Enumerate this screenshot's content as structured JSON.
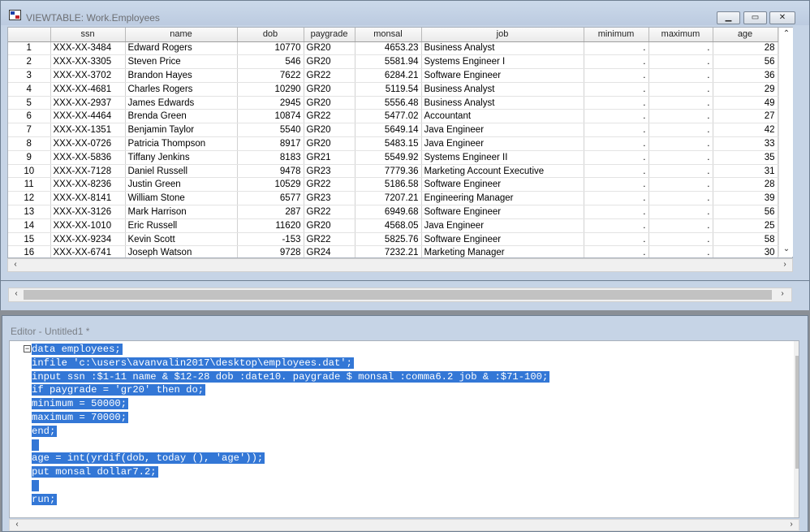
{
  "viewtable": {
    "title": "VIEWTABLE: Work.Employees",
    "columns": [
      "ssn",
      "name",
      "dob",
      "paygrade",
      "monsal",
      "job",
      "minimum",
      "maximum",
      "age"
    ],
    "rows": [
      [
        "1",
        "XXX-XX-3484",
        "Edward Rogers",
        "10770",
        "GR20",
        "4653.23",
        "Business Analyst",
        ".",
        ".",
        "28"
      ],
      [
        "2",
        "XXX-XX-3305",
        "Steven Price",
        "546",
        "GR20",
        "5581.94",
        "Systems Engineer I",
        ".",
        ".",
        "56"
      ],
      [
        "3",
        "XXX-XX-3702",
        "Brandon Hayes",
        "7622",
        "GR22",
        "6284.21",
        "Software Engineer",
        ".",
        ".",
        "36"
      ],
      [
        "4",
        "XXX-XX-4681",
        "Charles Rogers",
        "10290",
        "GR20",
        "5119.54",
        "Business Analyst",
        ".",
        ".",
        "29"
      ],
      [
        "5",
        "XXX-XX-2937",
        "James Edwards",
        "2945",
        "GR20",
        "5556.48",
        "Business Analyst",
        ".",
        ".",
        "49"
      ],
      [
        "6",
        "XXX-XX-4464",
        "Brenda Green",
        "10874",
        "GR22",
        "5477.02",
        "Accountant",
        ".",
        ".",
        "27"
      ],
      [
        "7",
        "XXX-XX-1351",
        "Benjamin Taylor",
        "5540",
        "GR20",
        "5649.14",
        "Java Engineer",
        ".",
        ".",
        "42"
      ],
      [
        "8",
        "XXX-XX-0726",
        "Patricia Thompson",
        "8917",
        "GR20",
        "5483.15",
        "Java Engineer",
        ".",
        ".",
        "33"
      ],
      [
        "9",
        "XXX-XX-5836",
        "Tiffany Jenkins",
        "8183",
        "GR21",
        "5549.92",
        "Systems Engineer II",
        ".",
        ".",
        "35"
      ],
      [
        "10",
        "XXX-XX-7128",
        "Daniel Russell",
        "9478",
        "GR23",
        "7779.36",
        "Marketing Account Executive",
        ".",
        ".",
        "31"
      ],
      [
        "11",
        "XXX-XX-8236",
        "Justin Green",
        "10529",
        "GR22",
        "5186.58",
        "Software Engineer",
        ".",
        ".",
        "28"
      ],
      [
        "12",
        "XXX-XX-8141",
        "William Stone",
        "6577",
        "GR23",
        "7207.21",
        "Engineering Manager",
        ".",
        ".",
        "39"
      ],
      [
        "13",
        "XXX-XX-3126",
        "Mark Harrison",
        "287",
        "GR22",
        "6949.68",
        "Software Engineer",
        ".",
        ".",
        "56"
      ],
      [
        "14",
        "XXX-XX-1010",
        "Eric Russell",
        "11620",
        "GR20",
        "4568.05",
        "Java Engineer",
        ".",
        ".",
        "25"
      ],
      [
        "15",
        "XXX-XX-9234",
        "Kevin Scott",
        "-153",
        "GR22",
        "5825.76",
        "Software Engineer",
        ".",
        ".",
        "58"
      ],
      [
        "16",
        "XXX-XX-6741",
        "Joseph Watson",
        "9728",
        "GR24",
        "7232.21",
        "Marketing Manager",
        ".",
        ".",
        "30"
      ]
    ]
  },
  "editor": {
    "title": "Editor - Untitled1 *",
    "lines": [
      "data employees;",
      "infile 'c:\\users\\avanvalin2017\\desktop\\employees.dat';",
      "input ssn :$1-11 name & $12-28 dob :date10. paygrade $ monsal :comma6.2 job & :$71-100;",
      "if paygrade = 'gr20' then do;",
      "minimum = 50000;",
      "maximum = 70000;",
      "end;",
      "",
      "age = int(yrdif(dob, today (), 'age'));",
      "put monsal dollar7.2;",
      "",
      "run;"
    ]
  },
  "colors": {
    "selection": "#3377d6",
    "window_frame": "#c6d4e6"
  }
}
